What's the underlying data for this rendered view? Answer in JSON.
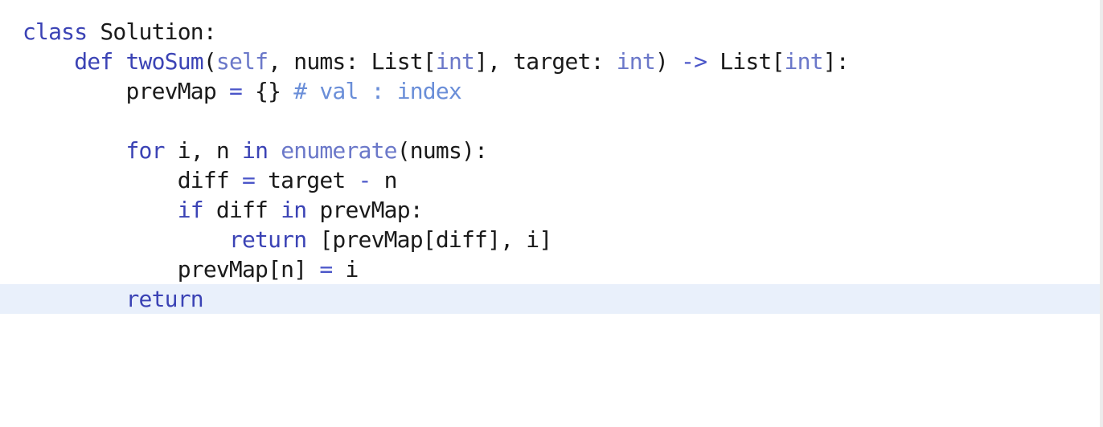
{
  "colors": {
    "keyword": "#3b43b5",
    "builtin": "#6b78c9",
    "comment": "#6a8ed8",
    "operator": "#4a55c8",
    "text": "#1a1a1a",
    "current_line_bg": "#e9f0fb"
  },
  "editor": {
    "current_line_index": 9,
    "lines": [
      {
        "indent": 0,
        "tokens": [
          {
            "t": "class",
            "k": "keyword"
          },
          {
            "t": " Solution:",
            "k": "text"
          }
        ]
      },
      {
        "indent": 4,
        "tokens": [
          {
            "t": "def",
            "k": "keyword"
          },
          {
            "t": " ",
            "k": "text"
          },
          {
            "t": "twoSum",
            "k": "keyword"
          },
          {
            "t": "(",
            "k": "text"
          },
          {
            "t": "self",
            "k": "builtin"
          },
          {
            "t": ", nums: List[",
            "k": "text"
          },
          {
            "t": "int",
            "k": "builtin"
          },
          {
            "t": "], target: ",
            "k": "text"
          },
          {
            "t": "int",
            "k": "builtin"
          },
          {
            "t": ") ",
            "k": "text"
          },
          {
            "t": "->",
            "k": "operator"
          },
          {
            "t": " List[",
            "k": "text"
          },
          {
            "t": "int",
            "k": "builtin"
          },
          {
            "t": "]:",
            "k": "text"
          }
        ]
      },
      {
        "indent": 8,
        "tokens": [
          {
            "t": "prevMap ",
            "k": "text"
          },
          {
            "t": "=",
            "k": "operator"
          },
          {
            "t": " {} ",
            "k": "text"
          },
          {
            "t": "# val : index",
            "k": "comment"
          }
        ]
      },
      {
        "indent": 0,
        "tokens": []
      },
      {
        "indent": 8,
        "tokens": [
          {
            "t": "for",
            "k": "keyword"
          },
          {
            "t": " i, n ",
            "k": "text"
          },
          {
            "t": "in",
            "k": "keyword"
          },
          {
            "t": " ",
            "k": "text"
          },
          {
            "t": "enumerate",
            "k": "builtin"
          },
          {
            "t": "(nums):",
            "k": "text"
          }
        ]
      },
      {
        "indent": 12,
        "tokens": [
          {
            "t": "diff ",
            "k": "text"
          },
          {
            "t": "=",
            "k": "operator"
          },
          {
            "t": " target ",
            "k": "text"
          },
          {
            "t": "-",
            "k": "operator"
          },
          {
            "t": " n",
            "k": "text"
          }
        ]
      },
      {
        "indent": 12,
        "tokens": [
          {
            "t": "if",
            "k": "keyword"
          },
          {
            "t": " diff ",
            "k": "text"
          },
          {
            "t": "in",
            "k": "keyword"
          },
          {
            "t": " prevMap:",
            "k": "text"
          }
        ]
      },
      {
        "indent": 16,
        "tokens": [
          {
            "t": "return",
            "k": "keyword"
          },
          {
            "t": " [prevMap[diff], i]",
            "k": "text"
          }
        ]
      },
      {
        "indent": 12,
        "tokens": [
          {
            "t": "prevMap[n] ",
            "k": "text"
          },
          {
            "t": "=",
            "k": "operator"
          },
          {
            "t": " i",
            "k": "text"
          }
        ]
      },
      {
        "indent": 8,
        "tokens": [
          {
            "t": "return",
            "k": "keyword"
          }
        ]
      }
    ]
  }
}
